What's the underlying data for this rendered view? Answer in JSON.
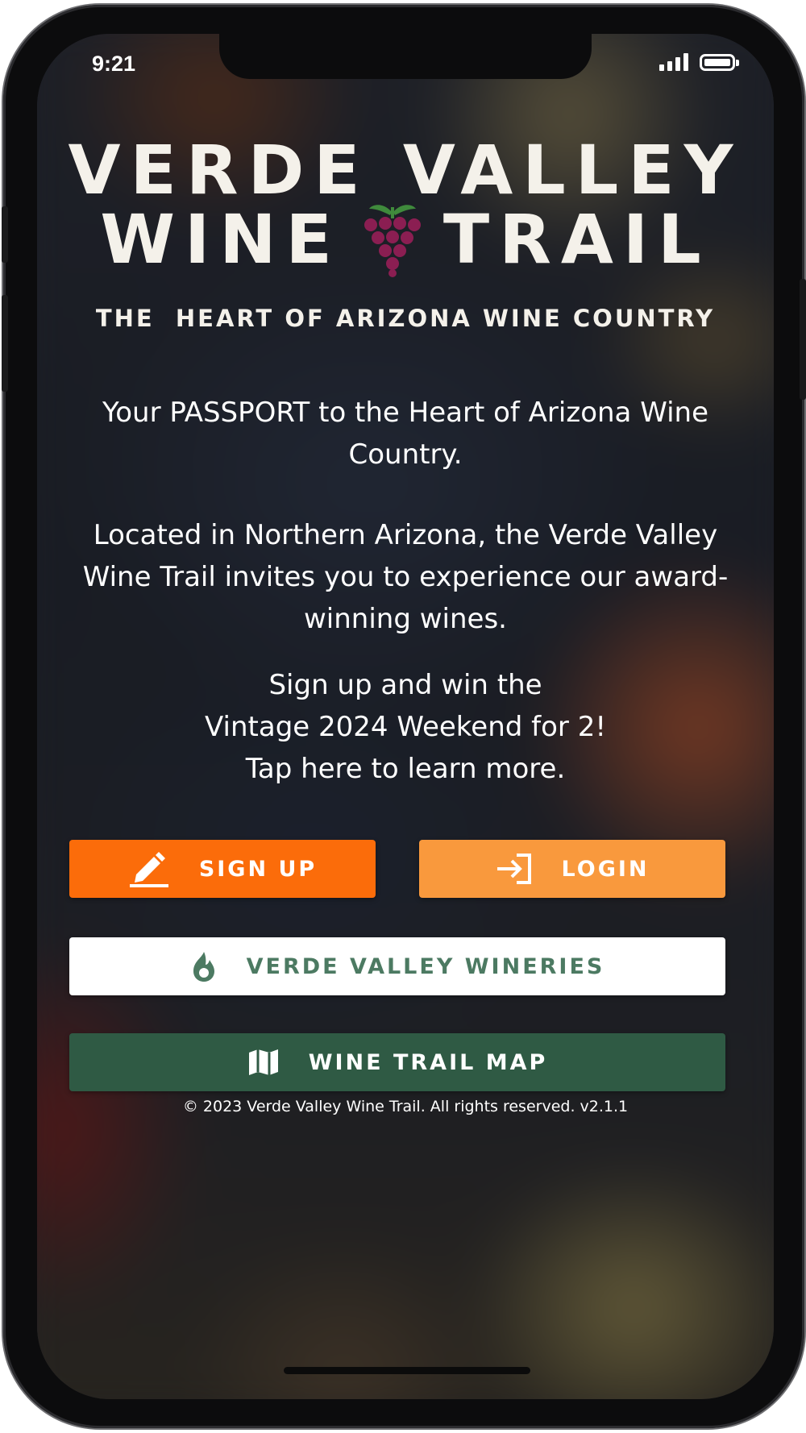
{
  "status_bar": {
    "time": "9:21",
    "icons": [
      "signal-icon",
      "battery-icon"
    ]
  },
  "logo": {
    "line1": "VERDE VALLEY",
    "line2_left": "WINE",
    "line2_right": "TRAIL",
    "tagline": "THE  HEART OF ARIZONA WINE COUNTRY",
    "icon": "grape-cluster-icon"
  },
  "intro": {
    "line1": "Your PASSPORT to the Heart of Arizona Wine Country.",
    "line2": "Located in Northern Arizona, the Verde Valley Wine Trail invites you to experience our award-winning wines.",
    "promo": [
      "Sign up and win the",
      "Vintage 2024 Weekend for 2!",
      "Tap here to learn more."
    ]
  },
  "buttons": {
    "signup": {
      "label": "SIGN UP",
      "icon": "pencil-icon"
    },
    "login": {
      "label": "LOGIN",
      "icon": "login-arrow-icon"
    },
    "wineries": {
      "label": "VERDE VALLEY WINERIES",
      "icon": "flame-icon"
    },
    "map": {
      "label": "WINE TRAIL MAP",
      "icon": "map-icon"
    }
  },
  "footer": {
    "text": "© 2023 Verde Valley Wine Trail. All rights reserved. v2.1.1"
  },
  "colors": {
    "signup": "#fb6c0a",
    "login": "#f9993d",
    "wineries_bg": "#ffffff",
    "wineries_text": "#4c7a62",
    "map": "#2f5a44",
    "grape": "#8b1e52",
    "leaf": "#3f8a3c"
  }
}
